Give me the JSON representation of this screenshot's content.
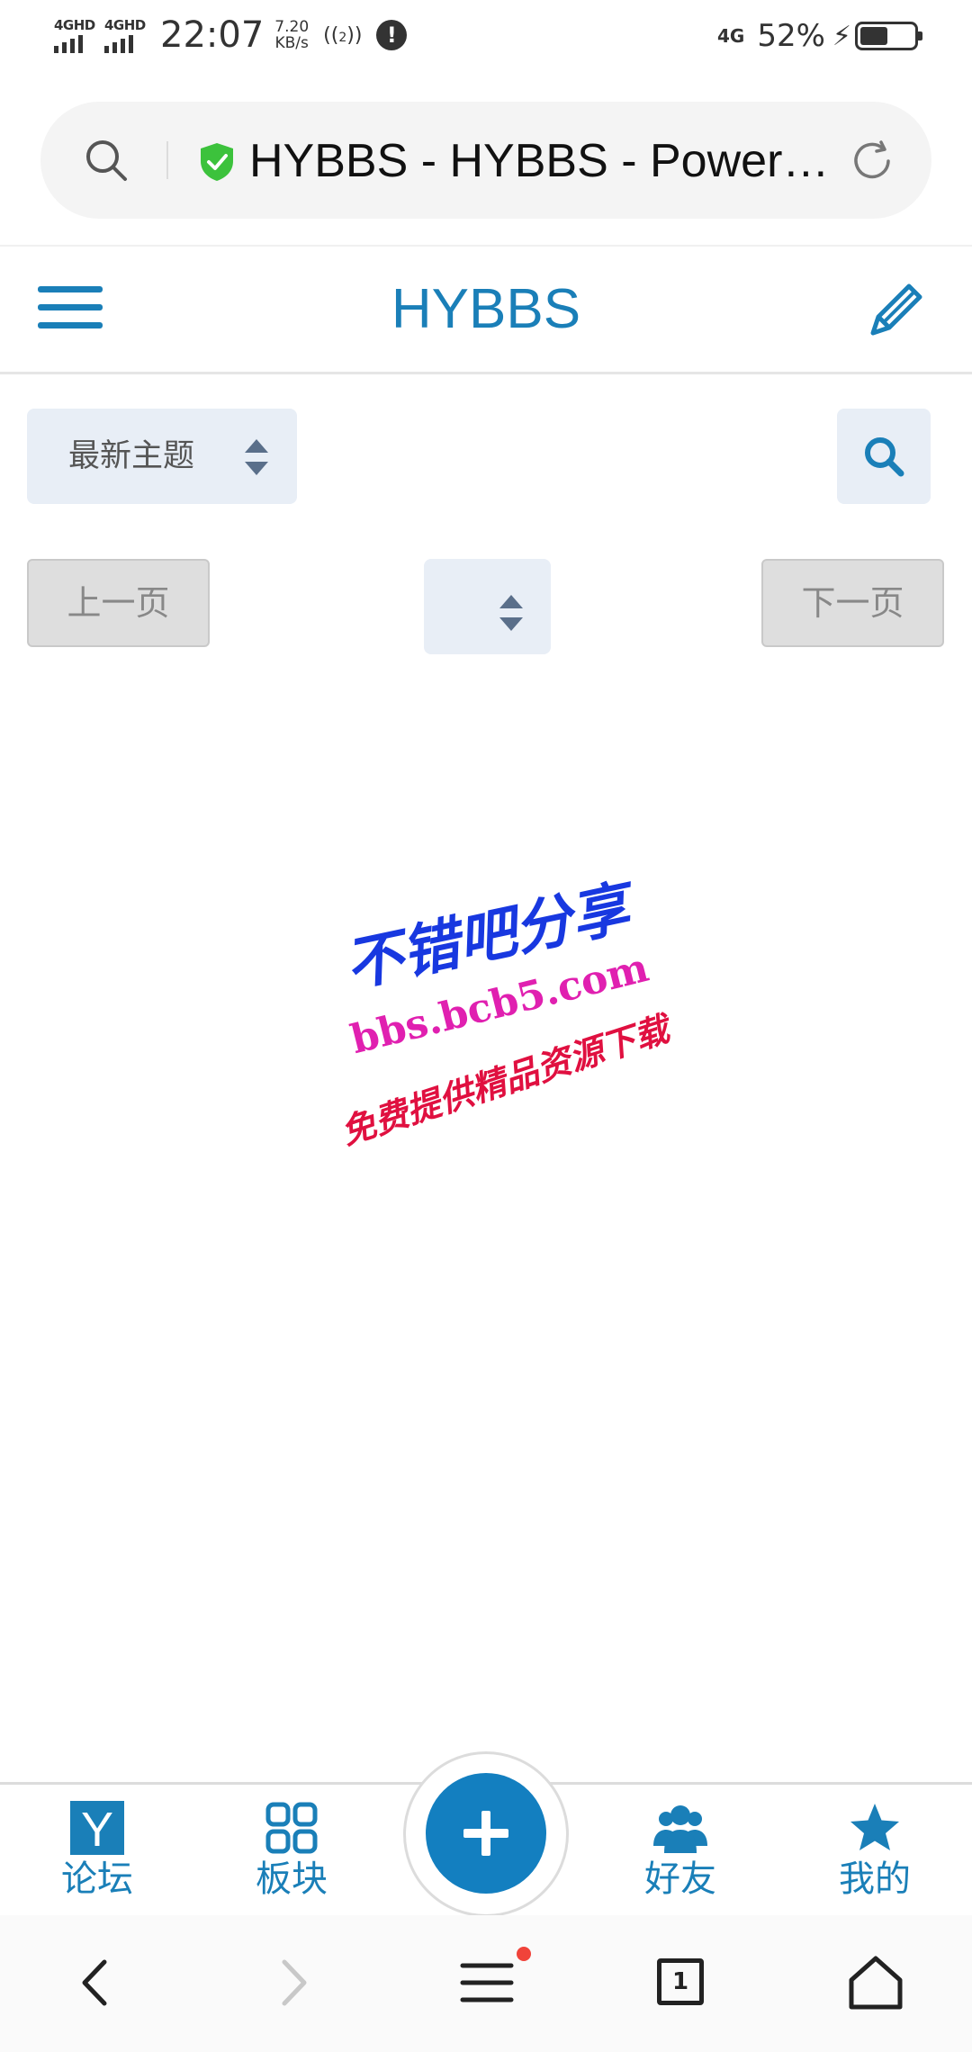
{
  "status_bar": {
    "network1": "4GHD",
    "network2": "4GHD",
    "time": "22:07",
    "speed_value": "7.20",
    "speed_unit": "KB/s",
    "hotspot_label": "2",
    "right_network": "4G",
    "battery_percent": "52%",
    "battery_level": 0.52
  },
  "address_bar": {
    "title": "HYBBS - HYBBS - Powered by HYBBS",
    "secure_color": "#3cc23c"
  },
  "header": {
    "title": "HYBBS"
  },
  "controls": {
    "sort_selected": "最新主题",
    "page_selected": "",
    "prev_label": "上一页",
    "next_label": "下一页"
  },
  "watermark": {
    "line1": "不错吧分享",
    "line2": "bbs.bcb5.com",
    "line3": "免费提供精品资源下载"
  },
  "tabbar": {
    "forum_label": "论坛",
    "board_label": "板块",
    "friends_label": "好友",
    "mine_label": "我的",
    "forum_icon_letter": "Y"
  },
  "navbar": {
    "tabs_count": "1"
  },
  "colors": {
    "accent": "#1a7fb8",
    "fab": "#137fc0",
    "select_bg": "#e8eef6",
    "disabled_btn": "#dedede"
  }
}
